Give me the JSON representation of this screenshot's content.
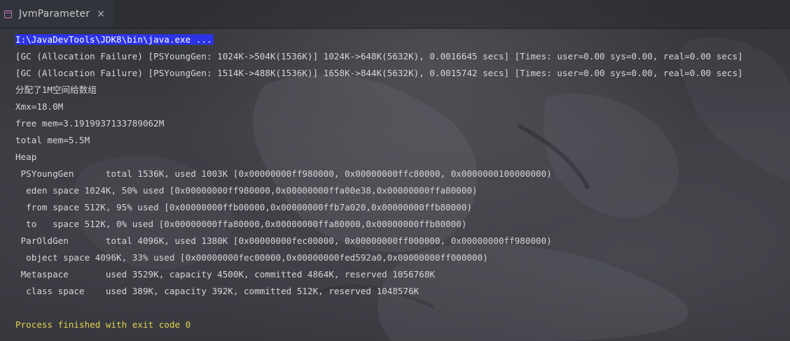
{
  "tab": {
    "title": "JvmParameter",
    "close_symbol": "×",
    "icon": "console-icon",
    "icon_color": "#c77dba"
  },
  "console": {
    "command": "I:\\JavaDevTools\\JDK8\\bin\\java.exe ...",
    "lines": [
      "[GC (Allocation Failure) [PSYoungGen: 1024K->504K(1536K)] 1024K->648K(5632K), 0.0016645 secs] [Times: user=0.00 sys=0.00, real=0.00 secs]",
      "[GC (Allocation Failure) [PSYoungGen: 1514K->488K(1536K)] 1658K->844K(5632K), 0.0015742 secs] [Times: user=0.00 sys=0.00, real=0.00 secs]",
      "分配了1M空间给数组",
      "Xmx=18.0M",
      "free mem=3.1919937133789062M",
      "total mem=5.5M",
      "Heap",
      " PSYoungGen      total 1536K, used 1003K [0x00000000ff980000, 0x00000000ffc80000, 0x0000000100000000)",
      "  eden space 1024K, 50% used [0x00000000ff980000,0x00000000ffa00e38,0x00000000ffa80000)",
      "  from space 512K, 95% used [0x00000000ffb00000,0x00000000ffb7a020,0x00000000ffb80000)",
      "  to   space 512K, 0% used [0x00000000ffa80000,0x00000000ffa80000,0x00000000ffb00000)",
      " ParOldGen       total 4096K, used 1380K [0x00000000fec00000, 0x00000000ff000000, 0x00000000ff980000)",
      "  object space 4096K, 33% used [0x00000000fec00000,0x00000000fed592a0,0x00000000ff000000)",
      " Metaspace       used 3529K, capacity 4500K, committed 4864K, reserved 1056768K",
      "  class space    used 389K, capacity 392K, committed 512K, reserved 1048576K"
    ],
    "exit_message": "Process finished with exit code 0"
  },
  "colors": {
    "command_highlight": "#2c33e6",
    "exit_message": "#e2d24d",
    "text": "#d6d6d6"
  }
}
